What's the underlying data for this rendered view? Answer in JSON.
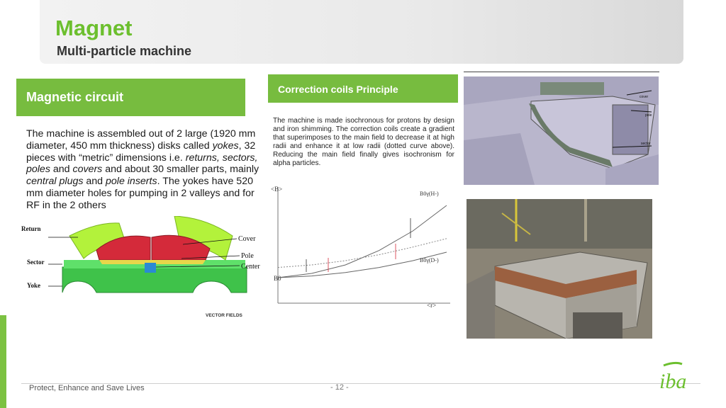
{
  "header": {
    "title": "Magnet",
    "subtitle": "Multi-particle machine"
  },
  "magnetic_circuit": {
    "heading": "Magnetic circuit",
    "text_parts": [
      "The machine is assembled out of 2 large (1920 mm diameter, 450 mm thickness) disks called ",
      "yokes",
      ", 32 pieces with “metric” dimensions i.e. ",
      "returns, sectors, poles",
      " and ",
      "covers",
      " and about 30 smaller parts,  mainly ",
      "central plugs",
      " and ",
      "pole inserts",
      ". The yokes have 520 mm diameter holes for pumping in 2 valleys and for RF in the 2 others"
    ],
    "figure_labels": {
      "return": "Return",
      "sector": "Sector",
      "yoke": "Yoke",
      "cover": "Cover",
      "pole": "Pole",
      "center": "Center",
      "credit": "VECTOR FIELDS"
    }
  },
  "correction_coils": {
    "heading": "Correction coils Principle",
    "text": "The machine is made isochronous for protons by design and iron shimming. The correction coils create a gradient that superimposes to the main field to decrease it at high radii and enhance it at low radii (dotted curve above). Reducing the main field finally gives isochronism for alpha particles."
  },
  "chart_data": {
    "type": "line",
    "title": "",
    "xlabel": "<r>",
    "ylabel": "<B>",
    "y_origin_label": "B0",
    "series": [
      {
        "name": "B0γ(H-)",
        "values": [
          0.0,
          0.05,
          0.15,
          0.32,
          0.55,
          0.85
        ]
      },
      {
        "name": "B0γ(D-)",
        "values": [
          0.0,
          0.02,
          0.06,
          0.12,
          0.2,
          0.3
        ]
      },
      {
        "name": "",
        "values": [
          0.12,
          0.15,
          0.2,
          0.27,
          0.36,
          0.46
        ]
      }
    ],
    "x": [
      0,
      0.2,
      0.4,
      0.6,
      0.8,
      1.0
    ],
    "grid": false
  },
  "photos": {
    "top_labels": {
      "cover": "cover",
      "pole": "pole",
      "sector": "sector"
    }
  },
  "footer": {
    "tagline": "Protect, Enhance and Save Lives",
    "page": "- 12 -",
    "logo_text": "iba"
  },
  "colors": {
    "accent_green": "#77bc3f",
    "title_green": "#6cbf2e",
    "magnet_green": "#56d24f",
    "magnet_red": "#d42a3a"
  }
}
